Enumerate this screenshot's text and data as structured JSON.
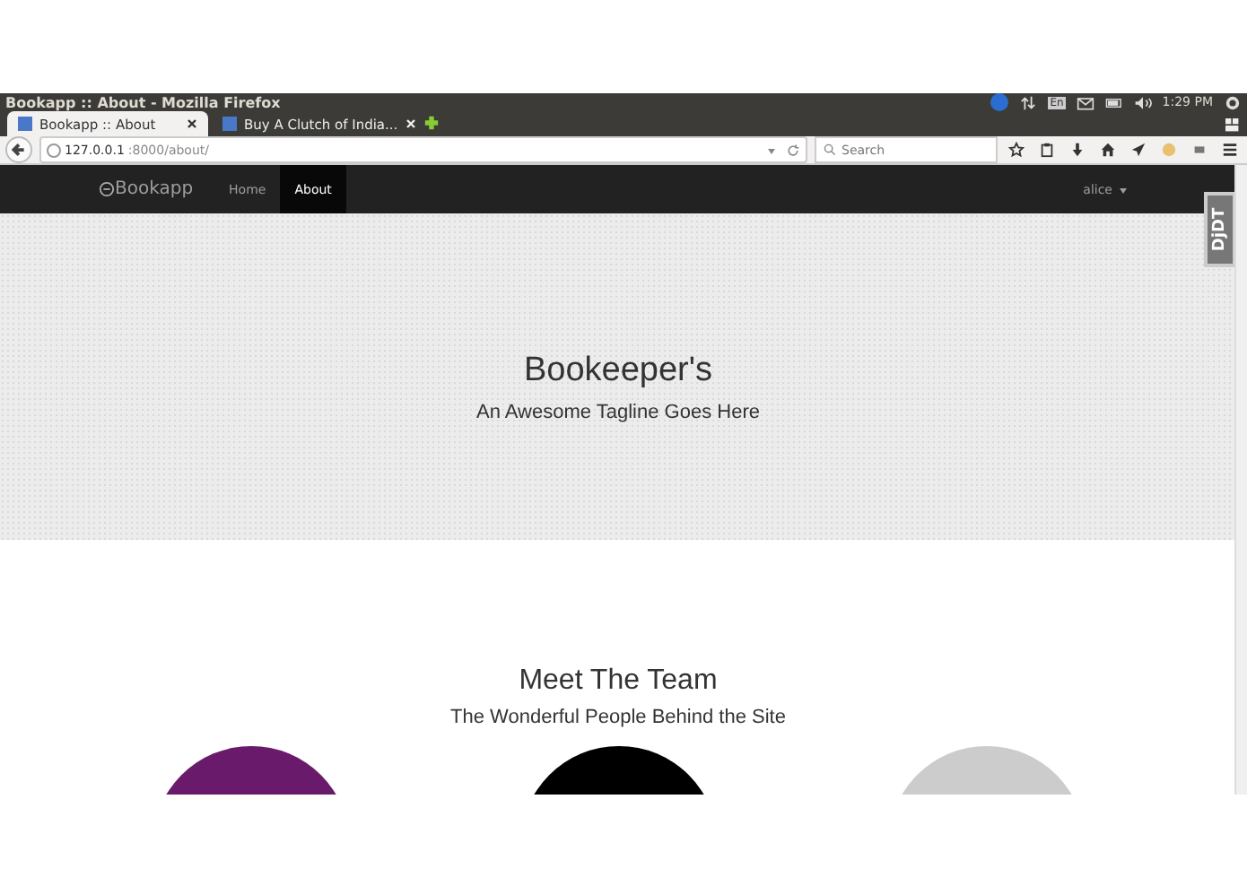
{
  "window": {
    "title": "Bookapp :: About - Mozilla Firefox"
  },
  "system_tray": {
    "clock": "1:29 PM",
    "keyboard": "En"
  },
  "tabs": [
    {
      "label": "Bookapp :: About",
      "selected": true
    },
    {
      "label": "Buy A Clutch of India...",
      "selected": false
    }
  ],
  "address_bar": {
    "host": "127.0.0.1",
    "path": ":8000/about/"
  },
  "search": {
    "placeholder": "Search"
  },
  "navbar": {
    "brand": "Bookapp",
    "links": [
      {
        "label": "Home",
        "selected": false
      },
      {
        "label": "About",
        "selected": true
      }
    ],
    "user": "alice"
  },
  "debug_toolbar": {
    "label": "DjDT"
  },
  "hero": {
    "title": "Bookeeper's",
    "tagline": "An Awesome Tagline Goes Here"
  },
  "team": {
    "title": "Meet The Team",
    "subtitle": "The Wonderful People Behind the Site"
  }
}
